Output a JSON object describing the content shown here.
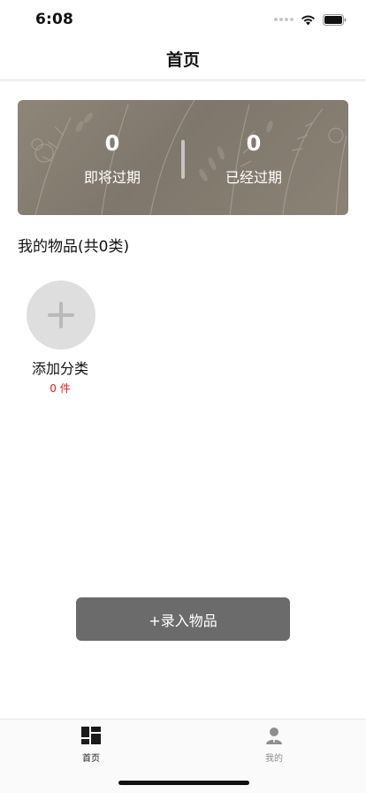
{
  "status_bar": {
    "time": "6:08"
  },
  "header": {
    "title": "首页"
  },
  "stats": {
    "expiring_count": "0",
    "expiring_label": "即将过期",
    "expired_count": "0",
    "expired_label": "已经过期"
  },
  "section": {
    "title": "我的物品(共0类)"
  },
  "categories": [
    {
      "label": "添加分类",
      "count": "0 件"
    }
  ],
  "actions": {
    "add_item_label": "+录入物品"
  },
  "tabs": [
    {
      "label": "首页",
      "icon": "dashboard-icon",
      "active": true
    },
    {
      "label": "我的",
      "icon": "user-icon",
      "active": false
    }
  ],
  "colors": {
    "accent_button": "#6b6b6b",
    "count_red": "#d62020",
    "banner": "#8a8275"
  }
}
